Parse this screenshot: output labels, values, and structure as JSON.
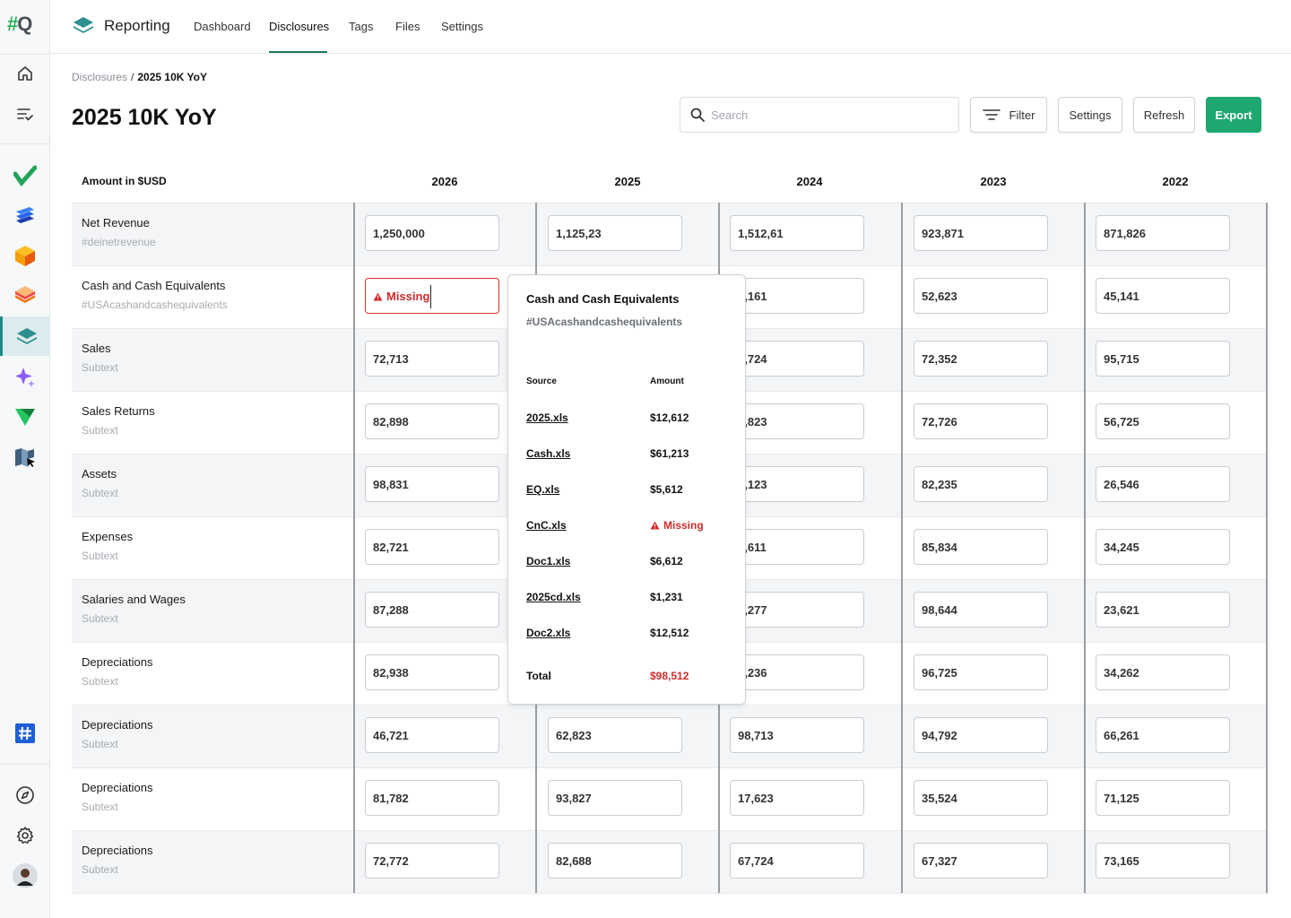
{
  "sidebar": {
    "logo_hash": "#",
    "logo_q": "Q",
    "icons": [
      "home-icon",
      "task-list-icon",
      "check-app-icon",
      "layers-blue-app-icon",
      "cube-app-icon",
      "stack-orange-app-icon",
      "reporting-app-icon",
      "sparkle-app-icon",
      "green-triangle-app-icon",
      "map-cursor-app-icon",
      "hashtag-app-icon",
      "compass-icon",
      "gear-icon",
      "avatar"
    ]
  },
  "topnav": {
    "brand": "Reporting",
    "tabs": [
      {
        "label": "Dashboard"
      },
      {
        "label": "Disclosures",
        "active": true
      },
      {
        "label": "Tags"
      },
      {
        "label": "Files"
      },
      {
        "label": "Settings"
      }
    ]
  },
  "breadcrumb": {
    "parent": "Disclosures",
    "separator": "/",
    "current": "2025 10K YoY"
  },
  "page_title": "2025 10K YoY",
  "search": {
    "placeholder": "Search"
  },
  "toolbar": {
    "filter": "Filter",
    "settings": "Settings",
    "refresh": "Refresh",
    "export": "Export"
  },
  "colors": {
    "accent": "#1ea870",
    "missing": "#d12a2a",
    "active_nav": "#1f7a52"
  },
  "table": {
    "header_label": "Amount in $USD",
    "years": [
      "2026",
      "2025",
      "2024",
      "2023",
      "2022"
    ],
    "rows": [
      {
        "label": "Net Revenue",
        "sub": "#deinetrevenue",
        "values": [
          "1,250,000",
          "1,125,23",
          "1,512,61",
          "923,871",
          "871,826"
        ]
      },
      {
        "label": "Cash and Cash Equivalents",
        "sub": "#USAcashandcashequivalents",
        "values": [
          "Missing",
          "",
          "2,161",
          "52,623",
          "45,141"
        ]
      },
      {
        "label": "Sales",
        "sub": "Subtext",
        "values": [
          "72,713",
          "",
          "2,724",
          "72,352",
          "95,715"
        ]
      },
      {
        "label": "Sales Returns",
        "sub": "Subtext",
        "values": [
          "82,898",
          "",
          "8,823",
          "72,726",
          "56,725"
        ]
      },
      {
        "label": "Assets",
        "sub": "Subtext",
        "values": [
          "98,831",
          "",
          "7,123",
          "82,235",
          "26,546"
        ]
      },
      {
        "label": "Expenses",
        "sub": "Subtext",
        "values": [
          "82,721",
          "",
          "1,611",
          "85,834",
          "34,245"
        ]
      },
      {
        "label": "Salaries and Wages",
        "sub": "Subtext",
        "values": [
          "87,288",
          "",
          "7,277",
          "98,644",
          "23,621"
        ]
      },
      {
        "label": "Depreciations",
        "sub": "Subtext",
        "values": [
          "82,938",
          "",
          "5,236",
          "96,725",
          "34,262"
        ]
      },
      {
        "label": "Depreciations",
        "sub": "Subtext",
        "values": [
          "46,721",
          "62,823",
          "98,713",
          "94,792",
          "66,261"
        ]
      },
      {
        "label": "Depreciations",
        "sub": "Subtext",
        "values": [
          "81,782",
          "93,827",
          "17,623",
          "35,524",
          "71,125"
        ]
      },
      {
        "label": "Depreciations",
        "sub": "Subtext",
        "values": [
          "72,772",
          "82,688",
          "67,724",
          "67,327",
          "73,165"
        ]
      }
    ]
  },
  "popover": {
    "title": "Cash and Cash Equivalents",
    "tag": "#USAcashandcashequivalents",
    "col_source": "Source",
    "col_amount": "Amount",
    "items": [
      {
        "source": "2025.xls",
        "amount": "$12,612"
      },
      {
        "source": "Cash.xls",
        "amount": "$61,213"
      },
      {
        "source": "EQ.xls",
        "amount": "$5,612"
      },
      {
        "source": "CnC.xls",
        "amount": "Missing",
        "missing": true
      },
      {
        "source": "Doc1.xls",
        "amount": "$6,612"
      },
      {
        "source": "2025cd.xls",
        "amount": "$1,231"
      },
      {
        "source": "Doc2.xls",
        "amount": "$12,512"
      }
    ],
    "total_label": "Total",
    "total_value": "$98,512"
  }
}
